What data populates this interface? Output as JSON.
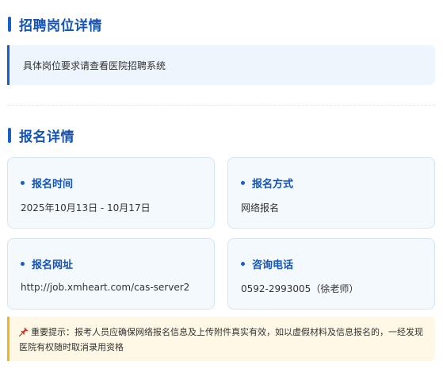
{
  "recruit": {
    "title": "招聘岗位详情",
    "note": "具体岗位要求请查看医院招聘系统"
  },
  "signup": {
    "title": "报名详情",
    "cards": [
      {
        "label": "报名时间",
        "value": "2025年10月13日 - 10月17日"
      },
      {
        "label": "报名方式",
        "value": "网络报名"
      },
      {
        "label": "报名网址",
        "value": "http://job.xmheart.com/cas-server2"
      },
      {
        "label": "咨询电话",
        "value": "0592-2993005（徐老师）"
      }
    ]
  },
  "notice": {
    "icon": "pushpin-icon",
    "text": "重要提示：报考人员应确保网络报名信息及上传附件真实有效，如以虚假材料及信息报名的，一经发现医院有权随时取消录用资格"
  },
  "colors": {
    "accent": "#1a5fc8",
    "title": "#1554b7",
    "note_bg": "#eef5fd",
    "warn_bg": "#fff8e6",
    "warn_border": "#f0b429"
  }
}
